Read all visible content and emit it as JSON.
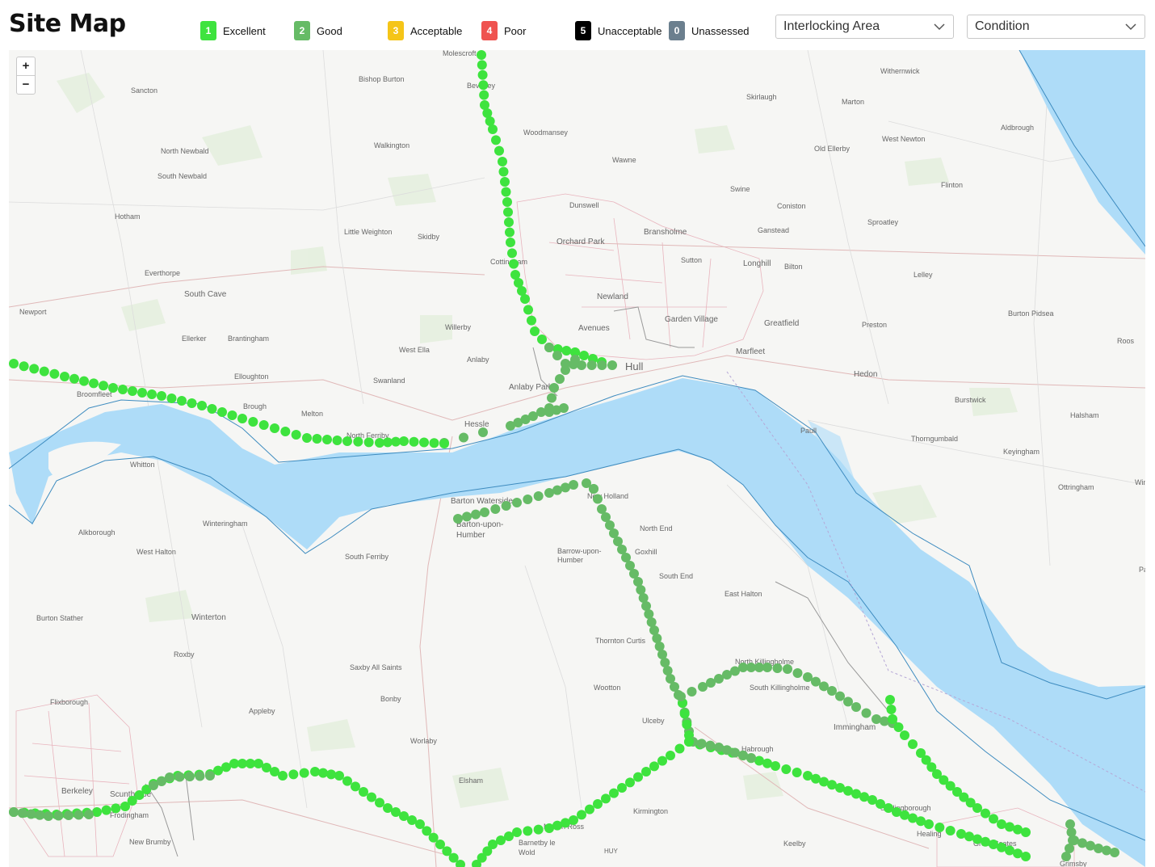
{
  "header": {
    "title": "Site Map"
  },
  "legend": [
    {
      "code": "1",
      "label": "Excellent",
      "color": "#3ee33e"
    },
    {
      "code": "2",
      "label": "Good",
      "color": "#66bb66"
    },
    {
      "code": "3",
      "label": "Acceptable",
      "color": "#f5c518"
    },
    {
      "code": "4",
      "label": "Poor",
      "color": "#ef5350"
    },
    {
      "code": "5",
      "label": "Unacceptable",
      "color": "#000000"
    },
    {
      "code": "0",
      "label": "Unassessed",
      "color": "#6b7f8e"
    }
  ],
  "filters": {
    "interlocking": {
      "value": "Interlocking Area"
    },
    "condition": {
      "value": "Condition"
    }
  },
  "map": {
    "zoom_in": "+",
    "zoom_out": "−",
    "colors": {
      "water": "#aedcf8",
      "excellent": "#3ee33e",
      "good": "#66bb66"
    },
    "places": [
      {
        "n": "Molescroft",
        "s": "s"
      },
      {
        "n": "Bishop Burton",
        "s": "s"
      },
      {
        "n": "Beverley",
        "s": "s"
      },
      {
        "n": "Sancton",
        "s": "s"
      },
      {
        "n": "Woodmansey",
        "s": "s"
      },
      {
        "n": "Walkington",
        "s": "s"
      },
      {
        "n": "North Newbald",
        "s": "s"
      },
      {
        "n": "South Newbald",
        "s": "s"
      },
      {
        "n": "Wawne",
        "s": "s"
      },
      {
        "n": "Dunswell",
        "s": "s"
      },
      {
        "n": "Hotham",
        "s": "s"
      },
      {
        "n": "Little Weighton",
        "s": "s"
      },
      {
        "n": "Skidby",
        "s": "s"
      },
      {
        "n": "Orchard Park",
        "s": "m"
      },
      {
        "n": "Bransholme",
        "s": "m"
      },
      {
        "n": "Everthorpe",
        "s": "s"
      },
      {
        "n": "Cottingham",
        "s": "s"
      },
      {
        "n": "Sutton",
        "s": "s"
      },
      {
        "n": "Longhill",
        "s": "m"
      },
      {
        "n": "South Cave",
        "s": "m"
      },
      {
        "n": "Newland",
        "s": "m"
      },
      {
        "n": "Garden Village",
        "s": "m"
      },
      {
        "n": "Ellerker",
        "s": "s"
      },
      {
        "n": "Brantingham",
        "s": "s"
      },
      {
        "n": "Willerby",
        "s": "s"
      },
      {
        "n": "Avenues",
        "s": "m"
      },
      {
        "n": "West Ella",
        "s": "s"
      },
      {
        "n": "Anlaby",
        "s": "s"
      },
      {
        "n": "Hull",
        "s": "l"
      },
      {
        "n": "Elloughton",
        "s": "s"
      },
      {
        "n": "Swanland",
        "s": "s"
      },
      {
        "n": "Anlaby Park",
        "s": "m"
      },
      {
        "n": "Broomfleet",
        "s": "s"
      },
      {
        "n": "Brough",
        "s": "s"
      },
      {
        "n": "Melton",
        "s": "s"
      },
      {
        "n": "Hessle",
        "s": "m"
      },
      {
        "n": "North Ferriby",
        "s": "s"
      },
      {
        "n": "Whitton",
        "s": "s"
      },
      {
        "n": "Barton Waterside",
        "s": "m"
      },
      {
        "n": "Barton-upon-",
        "s": "m"
      },
      {
        "n": "Humber",
        "s": "m"
      },
      {
        "n": "New Holland",
        "s": "s"
      },
      {
        "n": "North End",
        "s": "s"
      },
      {
        "n": "Alkborough",
        "s": "s"
      },
      {
        "n": "Winteringham",
        "s": "s"
      },
      {
        "n": "West Halton",
        "s": "s"
      },
      {
        "n": "South Ferriby",
        "s": "s"
      },
      {
        "n": "Barrow-upon-",
        "s": "s"
      },
      {
        "n": "Humber",
        "s": "s"
      },
      {
        "n": "Goxhill",
        "s": "s"
      },
      {
        "n": "South End",
        "s": "s"
      },
      {
        "n": "East Halton",
        "s": "s"
      },
      {
        "n": "Burton Stather",
        "s": "s"
      },
      {
        "n": "Winterton",
        "s": "m"
      },
      {
        "n": "Roxby",
        "s": "s"
      },
      {
        "n": "Thornton Curtis",
        "s": "s"
      },
      {
        "n": "Saxby All Saints",
        "s": "s"
      },
      {
        "n": "North Killingholme",
        "s": "s"
      },
      {
        "n": "South Killingholme",
        "s": "s"
      },
      {
        "n": "Wootton",
        "s": "s"
      },
      {
        "n": "Bonby",
        "s": "s"
      },
      {
        "n": "Flixborough",
        "s": "s"
      },
      {
        "n": "Appleby",
        "s": "s"
      },
      {
        "n": "Ulceby",
        "s": "s"
      },
      {
        "n": "Immingham",
        "s": "m"
      },
      {
        "n": "Worlaby",
        "s": "s"
      },
      {
        "n": "Habrough",
        "s": "s"
      },
      {
        "n": "Berkeley",
        "s": "m"
      },
      {
        "n": "Scunthorpe",
        "s": "m"
      },
      {
        "n": "Elsham",
        "s": "s"
      },
      {
        "n": "Frodingham",
        "s": "s"
      },
      {
        "n": "Stallingborough",
        "s": "s"
      },
      {
        "n": "Kirmington",
        "s": "s"
      },
      {
        "n": "New Brumby",
        "s": "s"
      },
      {
        "n": "Melton Ross",
        "s": "s"
      },
      {
        "n": "Barnetby le",
        "s": "s"
      },
      {
        "n": "Wold",
        "s": "s"
      },
      {
        "n": "HUY",
        "s": "s"
      },
      {
        "n": "Healing",
        "s": "s"
      },
      {
        "n": "Keelby",
        "s": "s"
      },
      {
        "n": "Great Coates",
        "s": "s"
      },
      {
        "n": "Grimsby",
        "s": "s"
      },
      {
        "n": "Withernwick",
        "s": "s"
      },
      {
        "n": "Skirlaugh",
        "s": "s"
      },
      {
        "n": "Marton",
        "s": "s"
      },
      {
        "n": "Aldbrough",
        "s": "s"
      },
      {
        "n": "Old Ellerby",
        "s": "s"
      },
      {
        "n": "West Newton",
        "s": "s"
      },
      {
        "n": "Flinton",
        "s": "s"
      },
      {
        "n": "Swine",
        "s": "s"
      },
      {
        "n": "Coniston",
        "s": "s"
      },
      {
        "n": "Ganstead",
        "s": "s"
      },
      {
        "n": "Sproatley",
        "s": "s"
      },
      {
        "n": "Bilton",
        "s": "s"
      },
      {
        "n": "Lelley",
        "s": "s"
      },
      {
        "n": "Burton Pidsea",
        "s": "s"
      },
      {
        "n": "Greatfield",
        "s": "m"
      },
      {
        "n": "Marfleet",
        "s": "m"
      },
      {
        "n": "Preston",
        "s": "s"
      },
      {
        "n": "Hedon",
        "s": "m"
      },
      {
        "n": "Roos",
        "s": "s"
      },
      {
        "n": "Burstwick",
        "s": "s"
      },
      {
        "n": "Halsham",
        "s": "s"
      },
      {
        "n": "Paull",
        "s": "s"
      },
      {
        "n": "Thorngumbald",
        "s": "s"
      },
      {
        "n": "Keyingham",
        "s": "s"
      },
      {
        "n": "Ottringham",
        "s": "s"
      },
      {
        "n": "Winestead",
        "s": "s"
      },
      {
        "n": "Patrington Haven",
        "s": "s"
      },
      {
        "n": "Newport",
        "s": "s"
      }
    ]
  }
}
